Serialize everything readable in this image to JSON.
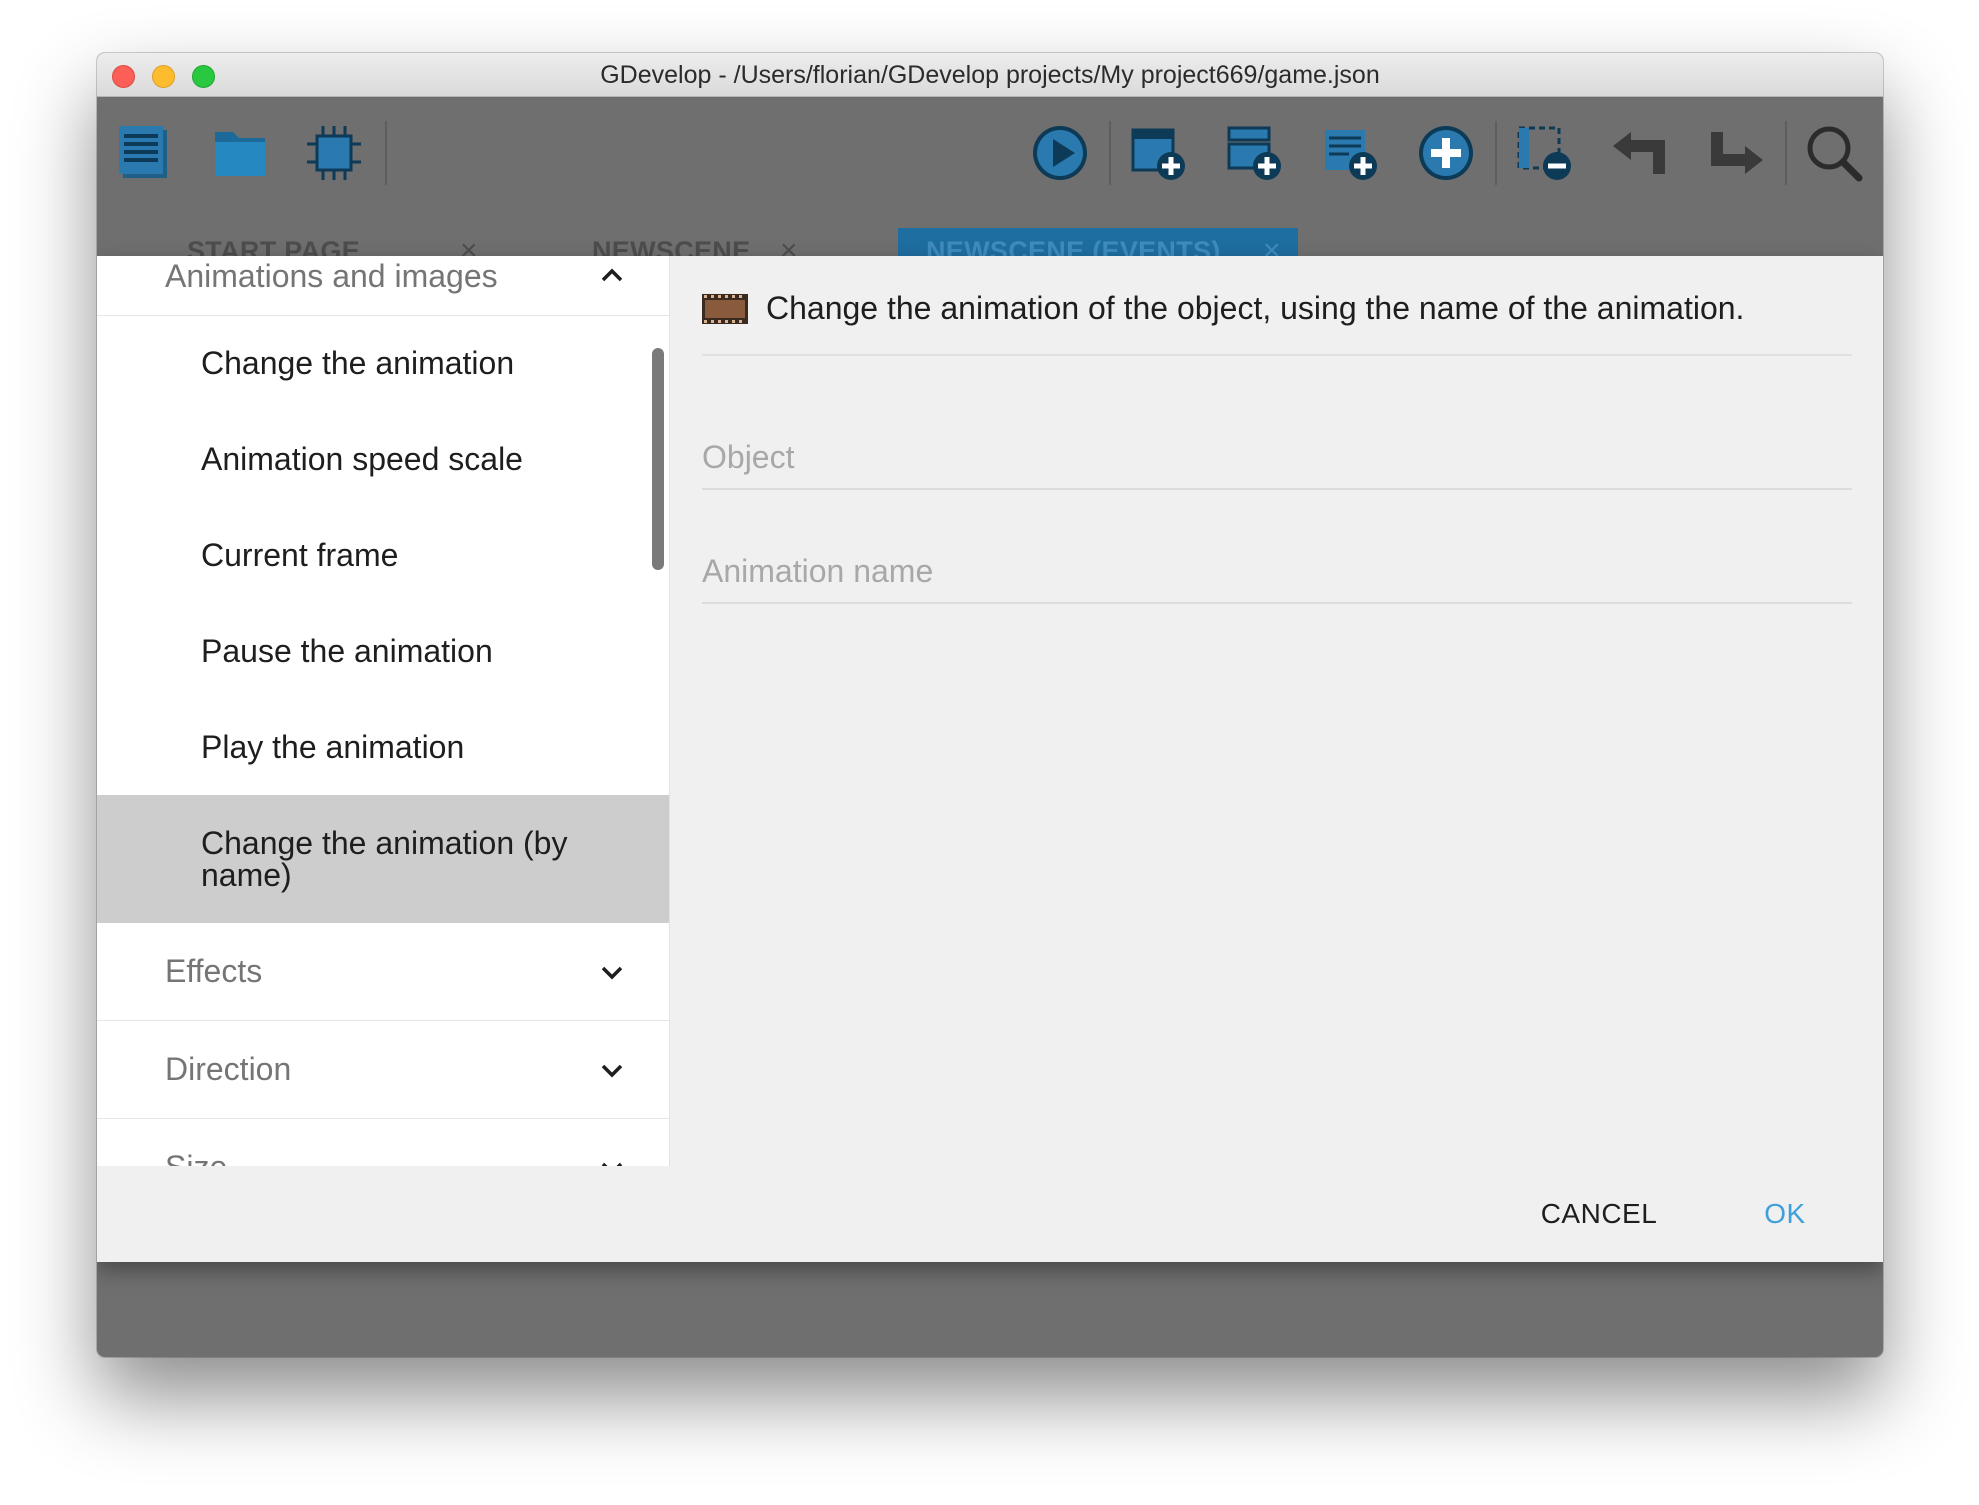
{
  "window": {
    "title": "GDevelop - /Users/florian/GDevelop projects/My project669/game.json"
  },
  "toolbar": {
    "left_icons": [
      "project-manager-icon",
      "open-folder-icon",
      "extensions-icon"
    ],
    "right_icons": [
      "preview-play-icon",
      "add-scene-icon",
      "add-external-events-icon",
      "add-event-icon",
      "add-circle-icon",
      "delete-selection-icon",
      "undo-icon",
      "redo-icon",
      "search-icon"
    ]
  },
  "tabs": [
    {
      "label": "START PAGE",
      "active": false
    },
    {
      "label": "NEWSCENE",
      "active": false
    },
    {
      "label": "NEWSCENE (EVENTS)",
      "active": true
    }
  ],
  "sidebar": {
    "current_group": "Animations and images",
    "items": [
      {
        "label": "Change the animation"
      },
      {
        "label": "Animation speed scale"
      },
      {
        "label": "Current frame"
      },
      {
        "label": "Pause the animation"
      },
      {
        "label": "Play the animation"
      },
      {
        "label": "Change the animation (by name)",
        "selected": true
      }
    ],
    "groups": [
      {
        "label": "Effects"
      },
      {
        "label": "Direction"
      },
      {
        "label": "Size"
      }
    ]
  },
  "instruction": {
    "description": "Change the animation of the object, using the name of the animation.",
    "icon": "film-strip-icon",
    "fields": [
      {
        "placeholder": "Object",
        "value": ""
      },
      {
        "placeholder": "Animation name",
        "value": ""
      }
    ]
  },
  "actions": {
    "cancel_label": "CANCEL",
    "ok_label": "OK"
  },
  "colors": {
    "accent": "#3d9fdc",
    "active_tab": "#1f6ea1",
    "selected_item": "#cdcdcd"
  }
}
